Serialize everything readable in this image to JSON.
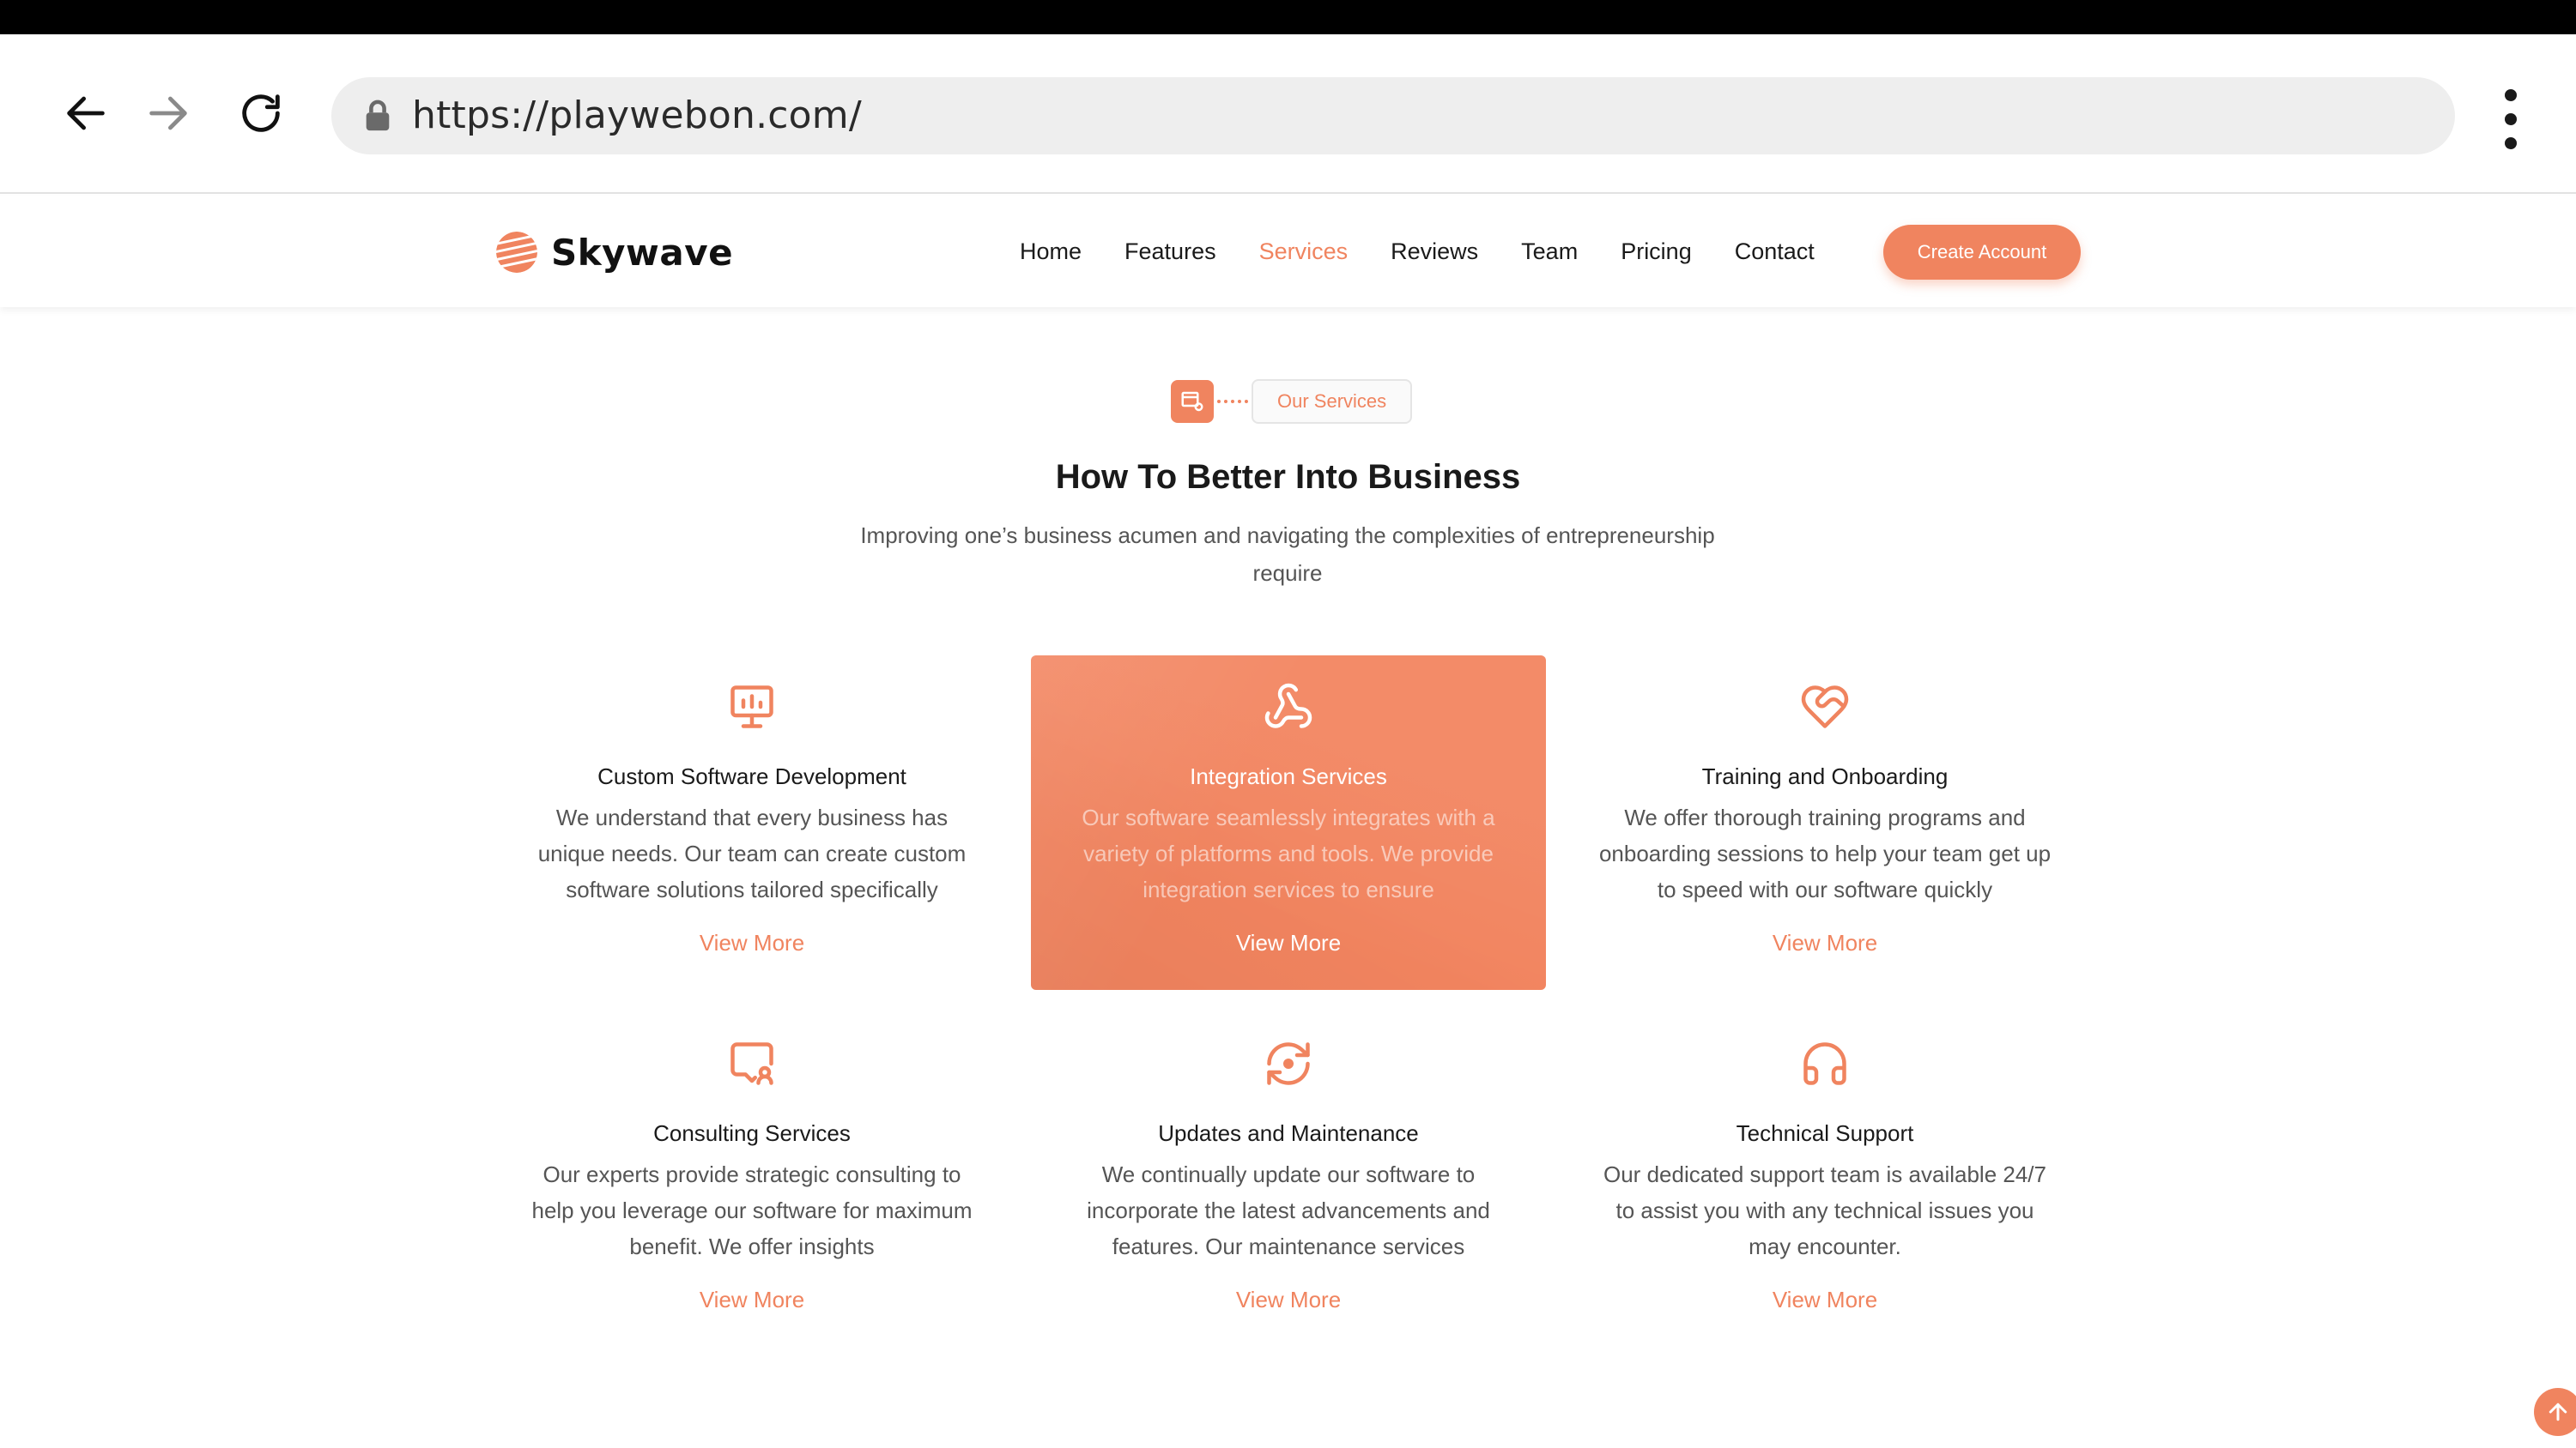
{
  "browser": {
    "url": "https://playwebon.com/"
  },
  "site": {
    "brand": "Skywave",
    "menu": [
      "Home",
      "Features",
      "Services",
      "Reviews",
      "Team",
      "Pricing",
      "Contact"
    ],
    "active_menu": "Services",
    "cta_label": "Create Account"
  },
  "section": {
    "tag": "Our Services",
    "title": "How To Better Into Business",
    "subtitle": "Improving one’s business acumen and navigating the complexities of entrepreneurship require"
  },
  "services": [
    {
      "icon": "monitor-chart-icon",
      "title": "Custom Software Development",
      "description": "We understand that every business has unique needs. Our team can create custom software solutions tailored specifically",
      "link": "View More",
      "highlighted": false
    },
    {
      "icon": "webhook-icon",
      "title": "Integration Services",
      "description": "Our software seamlessly integrates with a variety of platforms and tools. We provide integration services to ensure",
      "link": "View More",
      "highlighted": true
    },
    {
      "icon": "heart-handshake-icon",
      "title": "Training and Onboarding",
      "description": "We offer thorough training programs and onboarding sessions to help your team get up to speed with our software quickly",
      "link": "View More",
      "highlighted": false
    },
    {
      "icon": "chat-user-icon",
      "title": "Consulting Services",
      "description": "Our experts provide strategic consulting to help you leverage our software for maximum benefit. We offer insights",
      "link": "View More",
      "highlighted": false
    },
    {
      "icon": "refresh-cycle-icon",
      "title": "Updates and Maintenance",
      "description": "We continually update our software to incorporate the latest advancements and features. Our maintenance services",
      "link": "View More",
      "highlighted": false
    },
    {
      "icon": "headset-icon",
      "title": "Technical Support",
      "description": "Our dedicated support team is available 24/7 to assist you with any technical issues you may encounter.",
      "link": "View More",
      "highlighted": false
    }
  ],
  "colors": {
    "accent": "#f0845f",
    "text": "#1a1a1a",
    "muted": "#555555"
  }
}
